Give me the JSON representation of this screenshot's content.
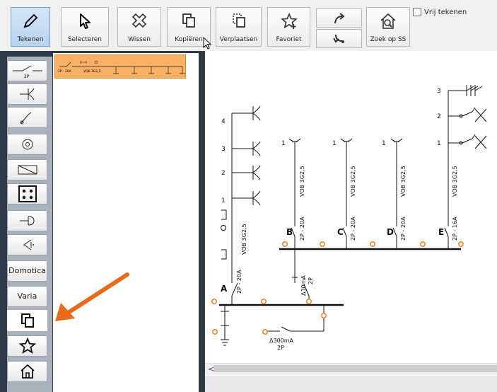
{
  "toolbar": {
    "draw_label": "Tekenen",
    "select_label": "Selecteren",
    "delete_label": "Wissen",
    "copy_label": "Kopiëren",
    "move_label": "Verplaatsen",
    "favorite_label": "Favoriet",
    "search_ss_label": "Zoek op SS",
    "free_draw_label": "Vrij tekenen"
  },
  "palette": {
    "switch_2p_label": "2P",
    "domotica_label": "Domotica",
    "varia_label": "Varia"
  },
  "favorite_preview": {
    "left_label": "2P - 20A",
    "cable_label": "VOB 3G2,5"
  },
  "schematic": {
    "circuit_a": "A",
    "circuit_b": "B",
    "circuit_c": "C",
    "circuit_d": "D",
    "circuit_e": "E",
    "cable_a": "VOB 3G2,5",
    "cable_b": "VOB 3G2,5",
    "cable_c": "VOB 3G2,5",
    "cable_d": "VOB 3G2,5",
    "cable_e": "VOB 3G2,5",
    "breaker_a": "2P - 20A",
    "breaker_b": "2P - 20A",
    "breaker_c": "2P - 20A",
    "breaker_d": "2P - 20A",
    "breaker_e": "2P - 16A",
    "rcd_main": "Δ300mA",
    "rcd_main_poles": "2P",
    "rcd_sub": "Δ30mA",
    "rcd_sub_poles": "2P",
    "a_numbers": [
      "4",
      "3",
      "2",
      "1"
    ],
    "b_number": "1",
    "c_number": "1",
    "d_number": "1",
    "e_numbers": [
      "3",
      "2",
      "1"
    ]
  },
  "colors": {
    "accent_orange": "#e86a1a",
    "sidebar_dark": "#2f3b49",
    "selection_fill": "#f8b064"
  }
}
